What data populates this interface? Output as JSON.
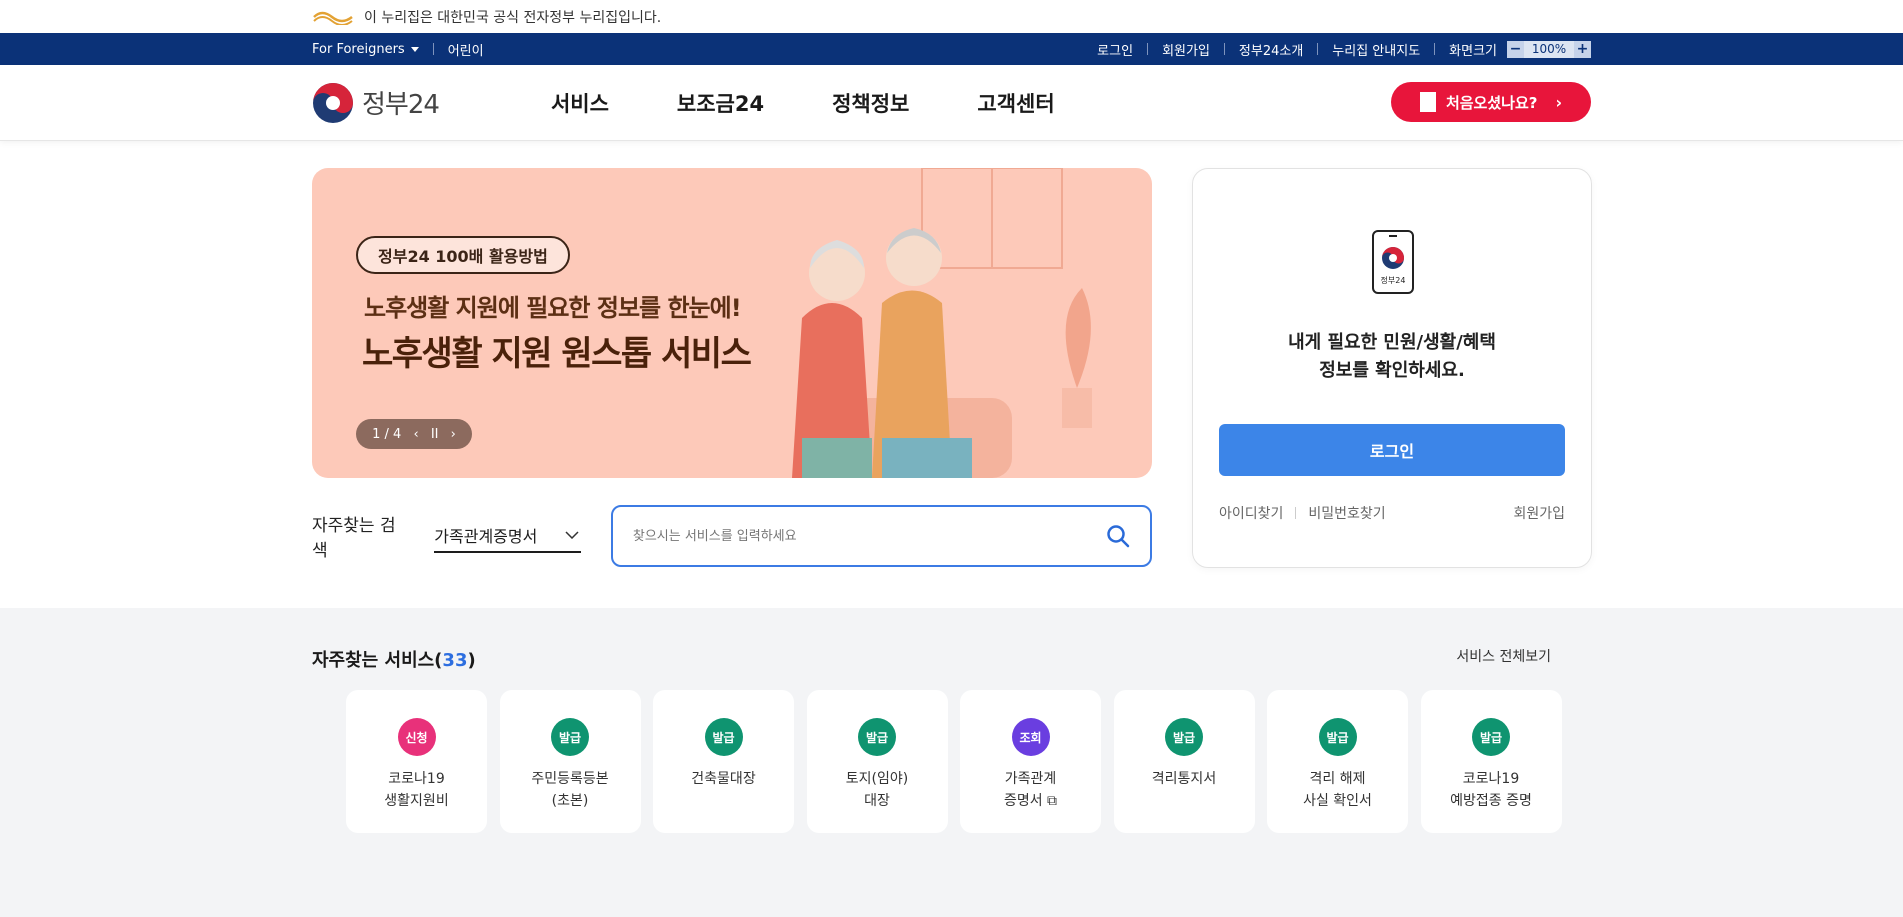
{
  "gov_notice": {
    "text": "이 누리집은 대한민국 공식 전자정부 누리집입니다."
  },
  "util_nav": {
    "foreigners": "For Foreigners",
    "kids": "어린이",
    "login": "로그인",
    "signup": "회원가입",
    "intro": "정부24소개",
    "sitemap": "누리집 안내지도",
    "screen_size": "화면크기",
    "zoom_minus": "−",
    "zoom_value": "100%",
    "zoom_plus": "+"
  },
  "header": {
    "logo_text": "정부24",
    "menu": [
      {
        "label": "서비스"
      },
      {
        "label": "보조금24"
      },
      {
        "label": "정책정보"
      },
      {
        "label": "고객센터"
      }
    ],
    "first_visit": "처음오셨나요?"
  },
  "banner": {
    "tag": "정부24 100배 활용방법",
    "subtitle": "노후생활 지원에 필요한 정보를 한눈에!",
    "title": "노후생활 지원 원스톱 서비스",
    "pager": "1 / 4",
    "prev": "‹",
    "pause": "II",
    "next": "›"
  },
  "search": {
    "freq_label": "자주찾는 검색",
    "freq_selected": "가족관계증명서",
    "placeholder": "찾으시는 서비스를 입력하세요"
  },
  "login_card": {
    "phone_label": "정부24",
    "message_line1": "내게 필요한 민원/생활/혜택",
    "message_line2": "정보를 확인하세요.",
    "login_button": "로그인",
    "find_id": "아이디찾기",
    "find_pw": "비밀번호찾기",
    "signup": "회원가입"
  },
  "services": {
    "title": "자주찾는 서비스(",
    "count": "33",
    "title_end": ")",
    "view_all": "서비스 전체보기",
    "items": [
      {
        "badge": "신청",
        "color": "#e8317a",
        "line1": "코로나19",
        "line2": "생활지원비"
      },
      {
        "badge": "발급",
        "color": "#0f9470",
        "line1": "주민등록등본",
        "line2": "(초본)"
      },
      {
        "badge": "발급",
        "color": "#0f9470",
        "line1": "건축물대장",
        "line2": ""
      },
      {
        "badge": "발급",
        "color": "#0f9470",
        "line1": "토지(임야)",
        "line2": "대장"
      },
      {
        "badge": "조회",
        "color": "#6a3ee0",
        "line1": "가족관계",
        "line2": "증명서 ⧉"
      },
      {
        "badge": "발급",
        "color": "#0f9470",
        "line1": "격리통지서",
        "line2": ""
      },
      {
        "badge": "발급",
        "color": "#0f9470",
        "line1": "격리 해제",
        "line2": "사실 확인서"
      },
      {
        "badge": "발급",
        "color": "#0f9470",
        "line1": "코로나19",
        "line2": "예방접종 증명"
      }
    ]
  }
}
